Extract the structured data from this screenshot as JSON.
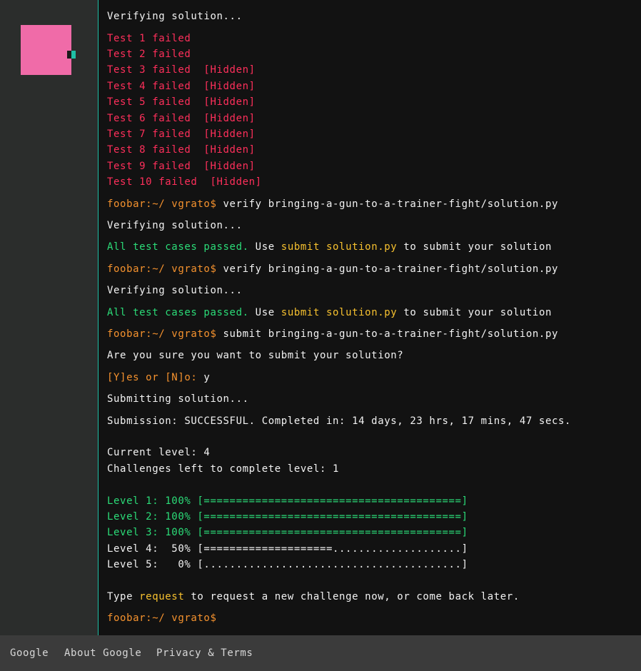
{
  "footer": {
    "links": [
      "Google",
      "About Google",
      "Privacy & Terms"
    ]
  },
  "terminal": {
    "prompt": "foobar:~/ vgrato$",
    "verifying": "Verifying solution...",
    "failed_tests": [
      {
        "text": "Test 1 failed",
        "hidden": ""
      },
      {
        "text": "Test 2 failed",
        "hidden": ""
      },
      {
        "text": "Test 3 failed",
        "hidden": "  [Hidden]"
      },
      {
        "text": "Test 4 failed",
        "hidden": "  [Hidden]"
      },
      {
        "text": "Test 5 failed",
        "hidden": "  [Hidden]"
      },
      {
        "text": "Test 6 failed",
        "hidden": "  [Hidden]"
      },
      {
        "text": "Test 7 failed",
        "hidden": "  [Hidden]"
      },
      {
        "text": "Test 8 failed",
        "hidden": "  [Hidden]"
      },
      {
        "text": "Test 9 failed",
        "hidden": "  [Hidden]"
      },
      {
        "text": "Test 10 failed",
        "hidden": "  [Hidden]"
      }
    ],
    "cmd_verify": " verify bringing-a-gun-to-a-trainer-fight/solution.py",
    "cmd_submit": " submit bringing-a-gun-to-a-trainer-fight/solution.py",
    "passed": "All test cases passed.",
    "use": " Use ",
    "submit_cmd": "submit solution.py",
    "to_submit": " to submit your solution",
    "confirm_question": "Are you sure you want to submit your solution?",
    "yes_no": "[Y]es or [N]o:",
    "answer": " y",
    "submitting": "Submitting solution...",
    "submission_result": "Submission: SUCCESSFUL. Completed in: 14 days, 23 hrs, 17 mins, 47 secs.",
    "current_level": "Current level: 4",
    "challenges_left": "Challenges left to complete level: 1",
    "levels": [
      {
        "text": "Level 1: 100% [========================================]",
        "complete": true
      },
      {
        "text": "Level 2: 100% [========================================]",
        "complete": true
      },
      {
        "text": "Level 3: 100% [========================================]",
        "complete": true
      },
      {
        "text": "Level 4:  50% [====================....................]",
        "complete": false
      },
      {
        "text": "Level 5:   0% [........................................]",
        "complete": false
      }
    ],
    "type": "Type ",
    "request": "request",
    "request_rest": " to request a new challenge now, or come back later."
  }
}
